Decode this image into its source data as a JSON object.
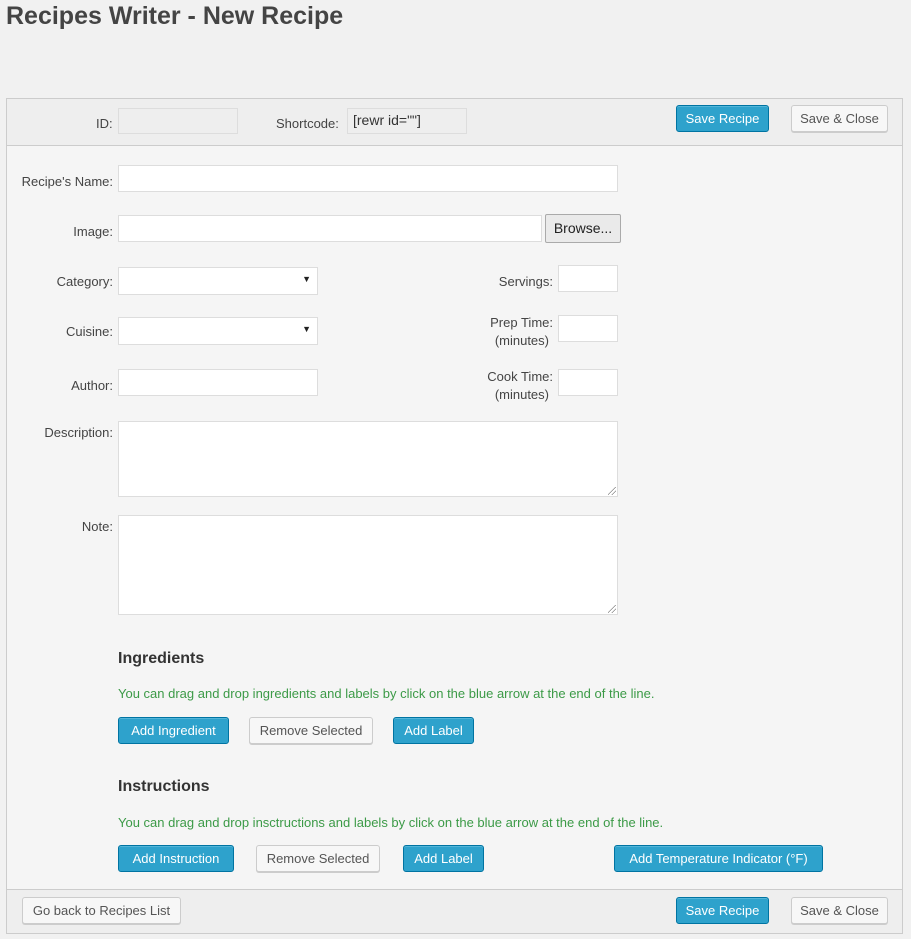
{
  "page": {
    "title": "Recipes Writer - New Recipe"
  },
  "top_bar": {
    "id_label": "ID:",
    "id_value": "",
    "shortcode_label": "Shortcode:",
    "shortcode_value": "[rewr id=\"\"]",
    "save_label": "Save Recipe",
    "save_close_label": "Save & Close"
  },
  "form": {
    "name_label": "Recipe's Name:",
    "name_value": "",
    "image_label": "Image:",
    "image_value": "",
    "browse_label": "Browse...",
    "category_label": "Category:",
    "category_value": "",
    "cuisine_label": "Cuisine:",
    "cuisine_value": "",
    "author_label": "Author:",
    "author_value": "",
    "servings_label": "Servings:",
    "servings_value": "",
    "prep_label_1": "Prep Time:",
    "prep_label_2": "(minutes)",
    "prep_value": "",
    "cook_label_1": "Cook Time:",
    "cook_label_2": "(minutes)",
    "cook_value": "",
    "description_label": "Description:",
    "description_value": "",
    "note_label": "Note:",
    "note_value": ""
  },
  "ingredients": {
    "title": "Ingredients",
    "hint": "You can drag and drop ingredients and labels by click on the blue arrow at the end of the line.",
    "add_label": "Add Ingredient",
    "remove_label": "Remove Selected",
    "add_label_label": "Add Label"
  },
  "instructions": {
    "title": "Instructions",
    "hint": "You can drag and drop insctructions and labels by click on the blue arrow at the end of the line.",
    "add_label": "Add Instruction",
    "remove_label": "Remove Selected",
    "add_label_label": "Add Label",
    "temp_label": "Add Temperature Indicator (°F)"
  },
  "bottom_bar": {
    "back_label": "Go back to Recipes List",
    "save_label": "Save Recipe",
    "save_close_label": "Save & Close"
  },
  "colors": {
    "primary": "#2ea2cc",
    "primary_border": "#0074a2",
    "hint_green": "#3c9a47"
  }
}
